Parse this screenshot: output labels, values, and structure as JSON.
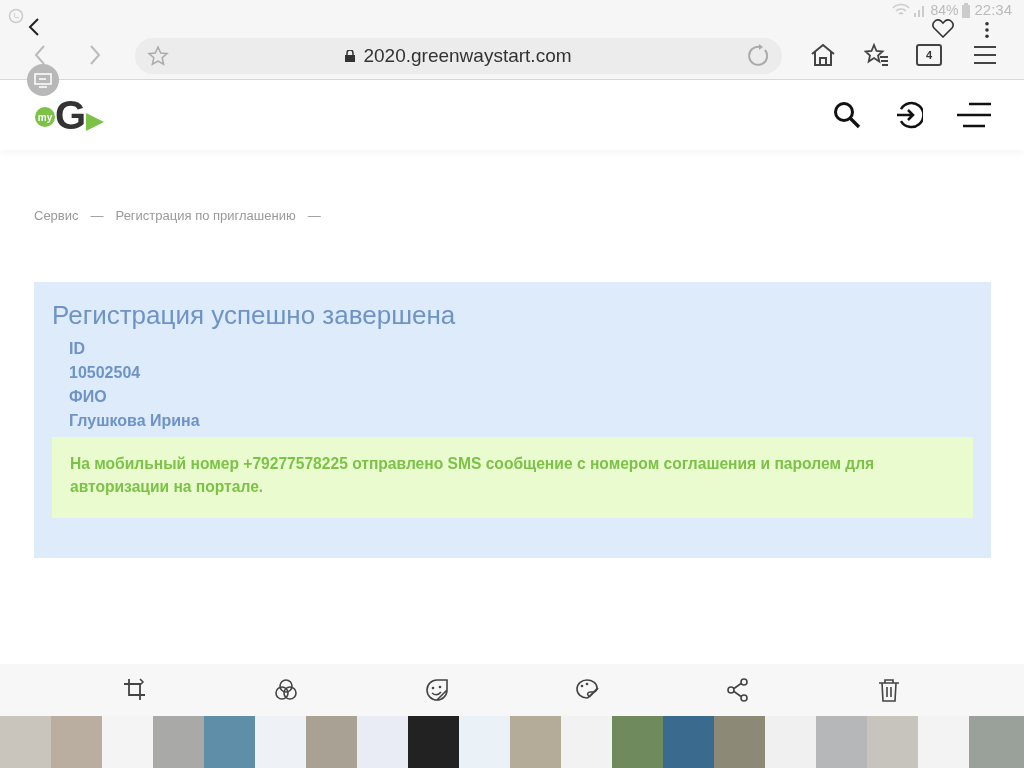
{
  "status_bar": {
    "battery": "84%",
    "time": "22:34"
  },
  "browser": {
    "url": "2020.greenwaystart.com",
    "tab_count": "4"
  },
  "site": {
    "logo_prefix": "my",
    "logo_letter": "G"
  },
  "breadcrumbs": [
    {
      "label": "Сервис",
      "separator": "—"
    },
    {
      "label": "Регистрация по приглашению",
      "separator": "—"
    }
  ],
  "result": {
    "title": "Регистрация успешно завершена",
    "fields": [
      {
        "label": "ID",
        "value": "10502504"
      },
      {
        "label": "ФИО",
        "value": "Глушкова Ирина"
      }
    ],
    "notice": "На мобильный номер **+79277578225** отправлено SMS сообщение с номером соглашения и паролем для авторизации на портале."
  },
  "editor_tools": [
    {
      "kind": "crop"
    },
    {
      "kind": "filter"
    },
    {
      "kind": "sticker"
    },
    {
      "kind": "paint"
    },
    {
      "kind": "share"
    },
    {
      "kind": "delete"
    }
  ]
}
